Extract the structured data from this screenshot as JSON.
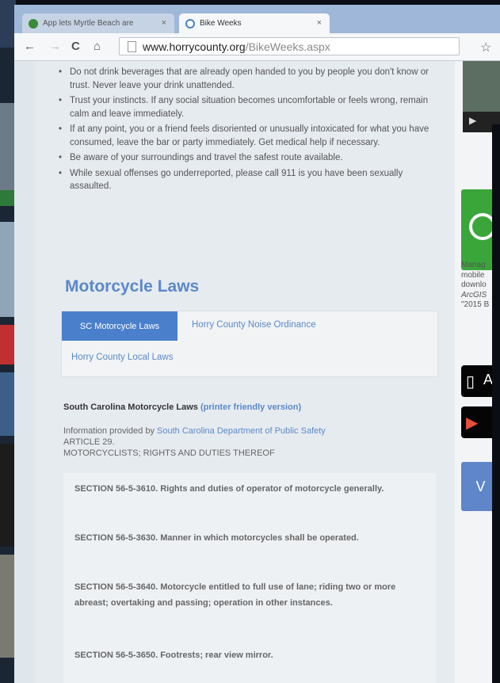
{
  "browser": {
    "tabs": [
      {
        "label": "App lets Myrtle Beach are",
        "close": "×"
      },
      {
        "label": "Bike Weeks",
        "close": "×"
      }
    ],
    "url": {
      "domain": "www.horrycounty.org",
      "path": "/BikeWeeks.aspx"
    }
  },
  "safety_tips": [
    "Do not drink beverages that are already open handed to you by people you don't know or trust. Never leave your drink unattended.",
    "Trust your instincts. If any social situation becomes uncomfortable or feels wrong, remain calm and leave immediately.",
    "If at any point, you or a friend feels disoriented or unusually intoxicated for what you have consumed, leave the bar or party immediately. Get medical help if necessary.",
    "Be aware of your surroundings and travel the safest route available.",
    "While sexual offenses go underreported, please call 911 is you have been sexually assaulted."
  ],
  "section_title": "Motorcycle Laws",
  "law_tabs": {
    "active": "SC Motorcycle Laws",
    "others": [
      "Horry County Noise Ordinance",
      "Horry County Local Laws"
    ]
  },
  "sc_laws": {
    "heading": "South Carolina Motorcycle Laws",
    "printer_link": "(printer friendly version)",
    "info_prefix": "Information provided by",
    "info_link": "South Carolina Department of Public Safety",
    "article": "ARTICLE 29.",
    "article_title": "MOTORCYCLISTS; RIGHTS AND DUTIES THEREOF",
    "sections": [
      "SECTION 56-5-3610. Rights and duties of operator of motorcycle generally.",
      "SECTION 56-5-3630. Manner in which motorcycles shall be operated.",
      "SECTION 56-5-3640. Motorcycle entitled to full use of lane; riding two or more abreast; overtaking and passing; operation in other instances.",
      "SECTION 56-5-3650. Footrests; rear view mirror."
    ]
  },
  "sidebar": {
    "text_lines": [
      "Manag",
      "mobile",
      "downlo",
      "ArcGIS",
      "\"2015 B"
    ],
    "store_labels": [
      "A",
      ""
    ],
    "view_button": "V"
  }
}
